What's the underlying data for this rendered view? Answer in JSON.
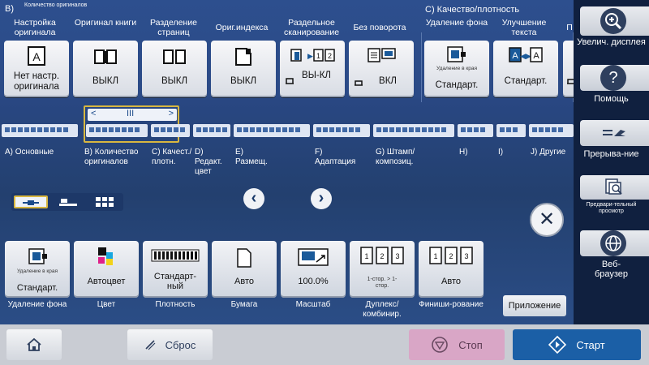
{
  "sections": {
    "b_letter": "B)",
    "b_name": "Количество оригиналов",
    "c_title": "C)   Качество/плотность"
  },
  "functions": [
    {
      "label": "Настройка оригинала",
      "value": "Нет настр. оригинала",
      "icon": "document-a-icon"
    },
    {
      "label": "Оригинал книги",
      "value": "ВЫКЛ",
      "icon": "book-icon"
    },
    {
      "label": "Разделение страниц",
      "value": "ВЫКЛ",
      "icon": "page-split-icon"
    },
    {
      "label": "Ориг.индекса",
      "value": "ВЫКЛ",
      "icon": "index-sheet-icon"
    },
    {
      "label": "Раздельное сканирование",
      "value": "ВЫ-КЛ",
      "icon": "separate-scan-icon",
      "pages": [
        "1",
        "2"
      ]
    },
    {
      "label": "Без поворота",
      "value": "ВКЛ",
      "icon": "no-rotate-icon"
    },
    {
      "label": "Удаление фона",
      "caption": "Удаление в края",
      "value": "Стандарт.",
      "icon": "background-removal-icon"
    },
    {
      "label": "Улучшение текста",
      "value": "Стандарт.",
      "icon": "text-enhance-icon"
    },
    {
      "label": "П",
      "icon": "partial-tile-icon"
    }
  ],
  "tabs": [
    {
      "id": "A",
      "label": "A) Основные"
    },
    {
      "id": "B",
      "label": "B) Количество оригиналов"
    },
    {
      "id": "C",
      "label": "C) Качест./ плотн."
    },
    {
      "id": "D",
      "label": "D) Редакт. цвет"
    },
    {
      "id": "E",
      "label": "E) Размещ."
    },
    {
      "id": "F",
      "label": "F) Адаптация"
    },
    {
      "id": "G",
      "label": "G) Штамп/ композиц."
    },
    {
      "id": "H",
      "label": "H)"
    },
    {
      "id": "I",
      "label": "I)"
    },
    {
      "id": "J",
      "label": "J) Другие"
    }
  ],
  "scroll": {
    "left": "<",
    "thumb": "III",
    "right": ">"
  },
  "view_modes": [
    "list-view-icon",
    "tile-view-icon",
    "grid-view-icon"
  ],
  "nav": {
    "prev": "‹",
    "next": "›"
  },
  "close_label": "✕",
  "shortcuts": [
    {
      "label": "Удаление фона",
      "caption": "Удаление в края",
      "value": "Стандарт.",
      "icon": "background-removal-icon"
    },
    {
      "label": "Цвет",
      "value": "Автоцвет",
      "icon": "color-squares-icon"
    },
    {
      "label": "Плотность",
      "value": "Стандарт-ный",
      "icon": "density-scale-icon"
    },
    {
      "label": "Бумага",
      "value": "Авто",
      "icon": "paper-sheet-icon"
    },
    {
      "label": "Масштаб",
      "value": "100.0%",
      "icon": "zoom-ratio-icon"
    },
    {
      "label": "Дуплекс/ комбинир.",
      "caption": "1-стор. > 1-стор.",
      "icon": "duplex-icon",
      "pages": [
        "1",
        "2",
        "3"
      ]
    },
    {
      "label": "Финиши-рование",
      "value": "Авто",
      "icon": "finishing-icon",
      "pages": [
        "1",
        "2",
        "3"
      ]
    }
  ],
  "app_button": "Приложение",
  "rightbar": [
    {
      "label": "Увелич. дисплея",
      "icon": "magnify-plus-icon"
    },
    {
      "label": "Помощь",
      "icon": "help-icon"
    },
    {
      "label": "Прерыва-ние",
      "icon": "interrupt-icon"
    },
    {
      "label": "Предвари-тельный просмотр",
      "icon": "preview-icon"
    },
    {
      "label": "Веб-браузер",
      "icon": "globe-icon"
    }
  ],
  "bottom": {
    "home": "home-icon",
    "reset": "Сброс",
    "stop": "Стоп",
    "start": "Старт"
  },
  "colors": {
    "accent": "#1a5a9a",
    "selection": "#d8b740",
    "stop": "#d9a6c6",
    "start": "#1b5fa6"
  }
}
